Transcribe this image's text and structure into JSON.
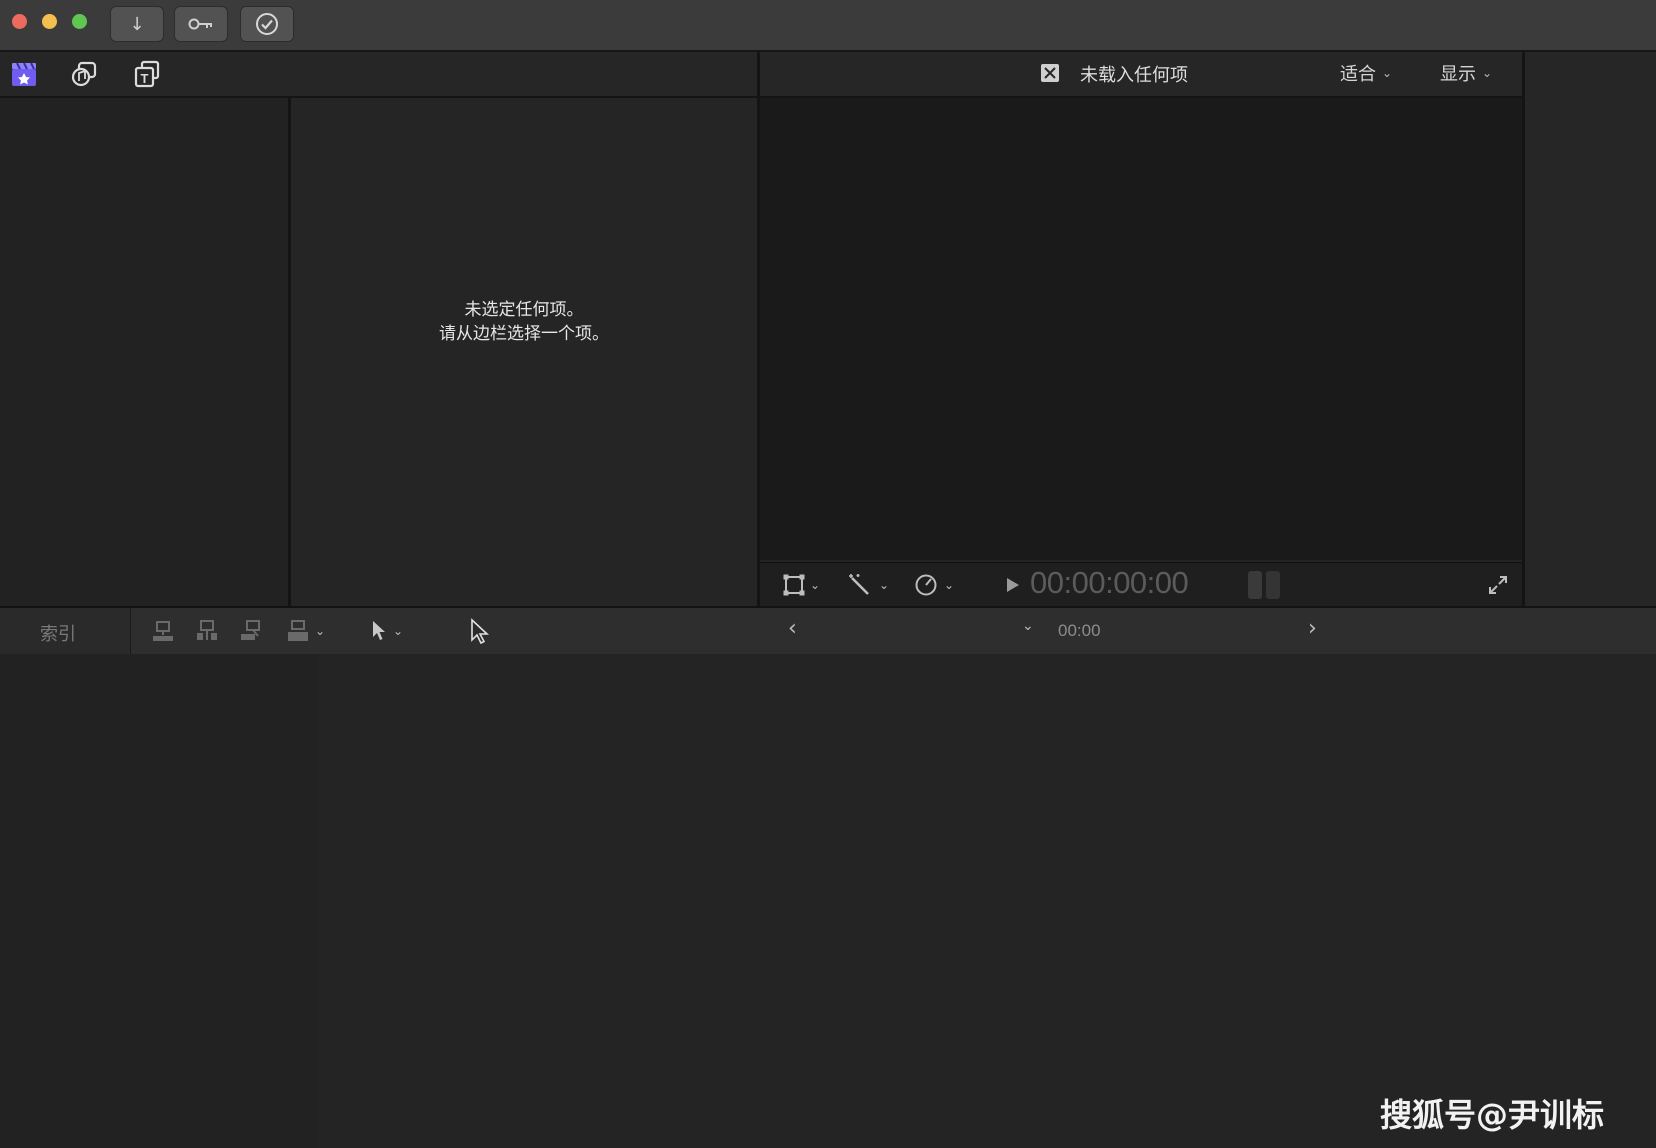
{
  "titlebar": {
    "traffic_colors": {
      "close": "#ed6a5e",
      "minimize": "#f5bf4f",
      "zoom": "#61c554"
    },
    "buttons": [
      {
        "icon": "download-arrow-icon",
        "glyph": "↓"
      },
      {
        "icon": "key-icon",
        "glyph": ""
      },
      {
        "icon": "checkmark-circle-icon",
        "glyph": ""
      }
    ]
  },
  "library_tabs": [
    {
      "icon": "clapperboard-icon"
    },
    {
      "icon": "photos-audio-icon"
    },
    {
      "icon": "titles-generators-icon"
    }
  ],
  "browser": {
    "empty_line1": "未选定任何项。",
    "empty_line2": "请从边栏选择一个项。"
  },
  "viewer": {
    "title": "未载入任何项",
    "fit_label": "适合",
    "view_label": "显示",
    "timecode": "00:00:00:00"
  },
  "timeline": {
    "index_label": "索引",
    "timecode": "00:00"
  },
  "watermark": "搜狐号@尹训标",
  "colors": {
    "accent": "#6f5cf0",
    "background": "#232323"
  }
}
